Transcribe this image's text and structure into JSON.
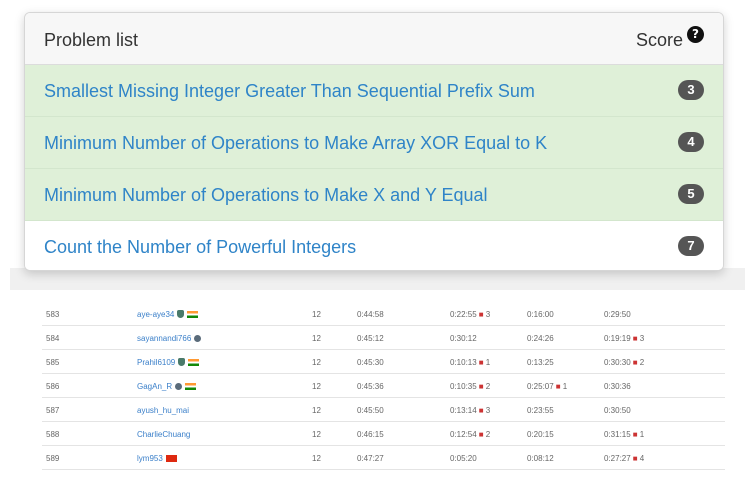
{
  "panel": {
    "title": "Problem list",
    "score_header": "Score",
    "help_icon": "?",
    "problems": [
      {
        "name": "Smallest Missing Integer Greater Than Sequential Prefix Sum",
        "score": "3",
        "solved": true
      },
      {
        "name": "Minimum Number of Operations to Make Array XOR Equal to K",
        "score": "4",
        "solved": true
      },
      {
        "name": "Minimum Number of Operations to Make X and Y Equal",
        "score": "5",
        "solved": true
      },
      {
        "name": "Count the Number of Powerful Integers",
        "score": "7",
        "solved": false
      }
    ]
  },
  "ranking": {
    "rows": [
      {
        "rank": "583",
        "user": "aye-aye34",
        "solved": "12",
        "time": "0:44:58",
        "p1": "0:22:55",
        "p1_pen": "3",
        "p2": "0:16:00",
        "p2_pen": "",
        "p3": "0:29:50",
        "p3_pen": ""
      },
      {
        "rank": "584",
        "user": "sayannandi766",
        "solved": "12",
        "time": "0:45:12",
        "p1": "0:30:12",
        "p1_pen": "",
        "p2": "0:24:26",
        "p2_pen": "",
        "p3": "0:19:19",
        "p3_pen": "3"
      },
      {
        "rank": "585",
        "user": "Prahil6109",
        "solved": "12",
        "time": "0:45:30",
        "p1": "0:10:13",
        "p1_pen": "1",
        "p2": "0:13:25",
        "p2_pen": "",
        "p3": "0:30:30",
        "p3_pen": "2"
      },
      {
        "rank": "586",
        "user": "GagAn_R",
        "solved": "12",
        "time": "0:45:36",
        "p1": "0:10:35",
        "p1_pen": "2",
        "p2": "0:25:07",
        "p2_pen": "1",
        "p3": "0:30:36",
        "p3_pen": ""
      },
      {
        "rank": "587",
        "user": "ayush_hu_mai",
        "solved": "12",
        "time": "0:45:50",
        "p1": "0:13:14",
        "p1_pen": "3",
        "p2": "0:23:55",
        "p2_pen": "",
        "p3": "0:30:50",
        "p3_pen": ""
      },
      {
        "rank": "588",
        "user": "CharlieChuang",
        "solved": "12",
        "time": "0:46:15",
        "p1": "0:12:54",
        "p1_pen": "2",
        "p2": "0:20:15",
        "p2_pen": "",
        "p3": "0:31:15",
        "p3_pen": "1"
      },
      {
        "rank": "589",
        "user": "lym953",
        "solved": "12",
        "time": "0:47:27",
        "p1": "0:05:20",
        "p1_pen": "",
        "p2": "0:08:12",
        "p2_pen": "",
        "p3": "0:27:27",
        "p3_pen": "4"
      }
    ]
  }
}
